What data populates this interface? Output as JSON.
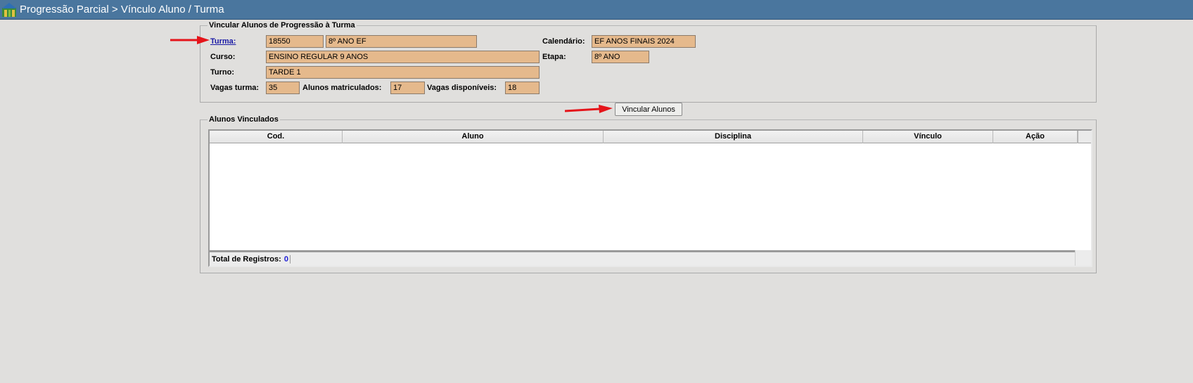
{
  "header": {
    "title": "Progressão Parcial > Vínculo Aluno / Turma",
    "icon": "app-logo-icon",
    "bg_color": "#4a769e"
  },
  "vincular": {
    "legend": "Vincular Alunos de Progressão à Turma",
    "turma_label": "Turma:",
    "turma_code": "18550",
    "turma_name": "8º ANO EF",
    "calendario_label": "Calendário:",
    "calendario_value": "EF ANOS FINAIS 2024",
    "curso_label": "Curso:",
    "curso_value": "ENSINO REGULAR 9 ANOS",
    "etapa_label": "Etapa:",
    "etapa_value": "8º ANO",
    "turno_label": "Turno:",
    "turno_value": "TARDE 1",
    "vagas_label": "Vagas turma:",
    "vagas_value": "35",
    "matriculados_label": "Alunos matriculados:",
    "matriculados_value": "17",
    "disponiveis_label": "Vagas disponíveis:",
    "disponiveis_value": "18",
    "field_color": "#e5b98c"
  },
  "actions": {
    "vincular_button": "Vincular Alunos"
  },
  "vinculados": {
    "legend": "Alunos Vinculados",
    "columns": [
      "Cod.",
      "Aluno",
      "Disciplina",
      "Vínculo",
      "Ação"
    ],
    "rows": [],
    "total_label": "Total de Registros:",
    "total_value": "0"
  }
}
